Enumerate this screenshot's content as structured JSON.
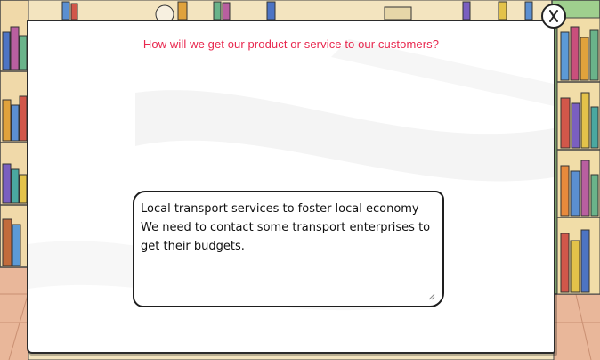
{
  "dialog": {
    "question": "How will we get our product or service to our customers?",
    "answer_lines": [
      "Local transport services to foster local economy",
      "We need to contact some transport enterprises to",
      "get their budgets."
    ]
  },
  "close_button": {
    "icon": "close-x-icon"
  },
  "colors": {
    "question_text": "#e8284f",
    "card_background": "#ffffff",
    "outline": "#222222"
  }
}
